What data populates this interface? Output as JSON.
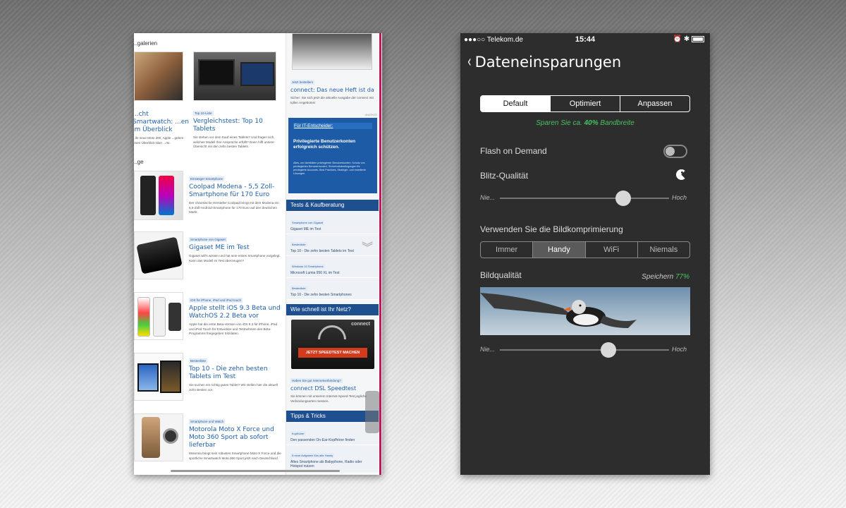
{
  "left": {
    "gallery_heading": "...galerien",
    "more_heading": "...ge",
    "gallery_cards": [
      {
        "title": "...cht Smartwatch: ...en im Überblick",
        "desc": "...lle neue Moto 360, Apple ...geben einen Überblick über ...rte."
      },
      {
        "tag": "Top 10-Liste",
        "title": "Vergleichstest: Top 10 Tablets",
        "desc": "Sie stehen vor dem Kauf eines Tablets? Und fragen sich, welches Modell Ihre Ansprüche erfüllt? Dann hilft unsere Übersicht mit den zehn besten Tablets."
      }
    ],
    "articles": [
      {
        "tag": "Einsteiger-Smartphone",
        "title": "Coolpad Modena - 5,5 Zoll-Smartphone für 170 Euro",
        "desc": "Der chinesische Hersteller Coolpad bringt mit dem Modena ein 5,5-Zoll-Android-Smartphone für 170 Euro auf den deutschen Markt."
      },
      {
        "tag": "Smartphone von Gigaset",
        "title": "Gigaset ME im Test",
        "desc": "Gigaset will's wissen und hat sein erstes Smartphone vorgelegt. Kann das Modell im Test überzeugen?"
      },
      {
        "tag": "iOS für iPhone, iPad und iPod touch",
        "title": "Apple stellt iOS 9.3 Beta und WatchOS 2.2 Beta vor",
        "desc": "Apple hat die erste Beta-Version von iOS 9.3 für iPhone, iPad und iPod Touch für Entwickler und Testnehmen des Beta-Programms freigegeben Sitzdaten."
      },
      {
        "tag": "Bestenliste",
        "title": "Top 10 - Die zehn besten Tablets im Test",
        "desc": "Sie suchen ein richtig gutes Tablet? Wir stellen hier die aktuell zehn Besten vor."
      },
      {
        "tag": "Smartphone und Watch",
        "title": "Motorola Moto X Force und Moto 360 Sport ab sofort lieferbar",
        "desc": "Motorola bringt sein robustes Smartphone Moto X Force und die sportliche Smartwatch Moto 360 Sport jetzt nach Deutschland."
      }
    ],
    "sidebar": {
      "heft_tag": "Jetzt bestellen!",
      "heft_title": "connect: Das neue Heft ist da",
      "heft_desc": "Sicher: Sie sich jetzt die aktuelle Ausgabe der connect mit tollen Angeboten!",
      "anzeige": "ANZEIGE",
      "ad_head": "Für IT-Entscheider:",
      "ad_title": "Privilegierte Benutzerkonten erfolgreich schützen.",
      "ad_body": "Alles, um Identitäten privilegierter Benutzerkonten: Schutz von privilegierten Benutzerkonten, Sicherheitsbedingungen für privilegierte Accounts, Best Practices, Strategie- und erweiterte Lösungen.",
      "tests_header": "Tests & Kaufberatung",
      "tests_items": [
        {
          "tag": "Smartphone von Gigaset",
          "label": "Gigaset ME im Test"
        },
        {
          "tag": "Bestenliste",
          "label": "Top 10 - Die zehn besten Tablets im Test"
        },
        {
          "tag": "Windows 10 Smartphone",
          "label": "Microsoft Lumia 950 XL im Test"
        },
        {
          "tag": "Bestenliste",
          "label": "Top 10 - Die zehn besten Smartphones"
        }
      ],
      "speed_header": "Wie schnell ist Ihr Netz?",
      "speed_brand": "connect",
      "speed_button": "JETZT SPEEDTEST MACHEN",
      "speed_tag": "Haben Sie gut Internetverbindung?",
      "speed_title": "connect DSL Speedtest",
      "speed_desc": "Sie können mit unserem Internet-Speed-Test jegliche Verbindungsarten messen.",
      "tips_header": "Tipps & Tricks",
      "tips_items": [
        {
          "tag": "Kopfhörer",
          "label": "Den passenden On-Ear-Kopfhörer finden"
        },
        {
          "tag": "5 neue Aufgaben fürs alte Handy",
          "label": "Altes Smartphone als Babyphone, Radio oder Hotspot nutzen"
        }
      ]
    }
  },
  "phone": {
    "status": {
      "carrier": "●●●○○ Telekom.de",
      "time": "15:44",
      "icons": "⏰ ✱"
    },
    "nav_title": "Dateneinsparungen",
    "back_glyph": "‹",
    "modes": [
      "Default",
      "Optimiert",
      "Anpassen"
    ],
    "active_mode": "Default",
    "savings_prefix": "Sparen Sie ca.",
    "savings_value": "40%",
    "savings_suffix": "Bandbreite",
    "flash_label": "Flash on Demand",
    "flash_on": false,
    "blitz_label": "Blitz-Qualität",
    "slider_low": "Nie...",
    "slider_high": "Hoch",
    "blitz_level": 0.73,
    "compress_label": "Verwenden Sie die Bildkomprimierung",
    "compress_options": [
      "Immer",
      "Handy",
      "WiFi",
      "Niemals"
    ],
    "compress_active": "Handy",
    "bild_label": "Bildqualität",
    "speichern_label": "Speichern",
    "speichern_value": "77%",
    "bild_level": 0.64,
    "accent": "#49c25f"
  }
}
